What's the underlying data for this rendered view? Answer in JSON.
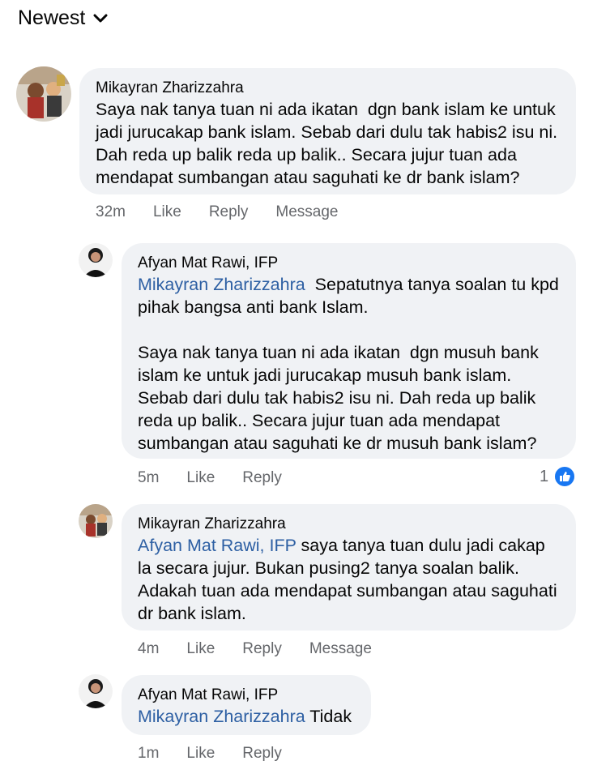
{
  "header": {
    "sort_label": "Newest"
  },
  "comments": [
    {
      "author": "Mikayran Zharizzahra",
      "mention": "",
      "text": "Saya nak tanya tuan ni ada ikatan  dgn bank islam ke untuk jadi jurucakap bank islam. Sebab dari dulu tak habis2 isu ni. Dah reda up balik reda up balik.. Secara jujur tuan ada mendapat sumbangan atau saguhati ke dr bank islam?",
      "time": "32m",
      "like": "Like",
      "reply": "Reply",
      "message": "Message"
    },
    {
      "author": "Afyan Mat Rawi, IFP",
      "mention": "Mikayran Zharizzahra",
      "text": "  Sepatutnya tanya soalan tu kpd pihak bangsa anti bank Islam.\n\nSaya nak tanya tuan ni ada ikatan  dgn musuh bank islam ke untuk jadi jurucakap musuh bank islam. Sebab dari dulu tak habis2 isu ni. Dah reda up balik reda up balik.. Secara jujur tuan ada mendapat sumbangan atau saguhati ke dr musuh bank islam?",
      "time": "5m",
      "like": "Like",
      "reply": "Reply",
      "reaction_count": "1"
    },
    {
      "author": "Mikayran Zharizzahra",
      "mention": "Afyan Mat Rawi, IFP",
      "text": " saya tanya tuan dulu jadi cakap la secara jujur. Bukan pusing2 tanya soalan balik. Adakah tuan ada mendapat sumbangan atau saguhati dr bank islam.",
      "time": "4m",
      "like": "Like",
      "reply": "Reply",
      "message": "Message"
    },
    {
      "author": "Afyan Mat Rawi, IFP",
      "mention": "Mikayran Zharizzahra",
      "text": " Tidak",
      "time": "1m",
      "like": "Like",
      "reply": "Reply"
    }
  ]
}
